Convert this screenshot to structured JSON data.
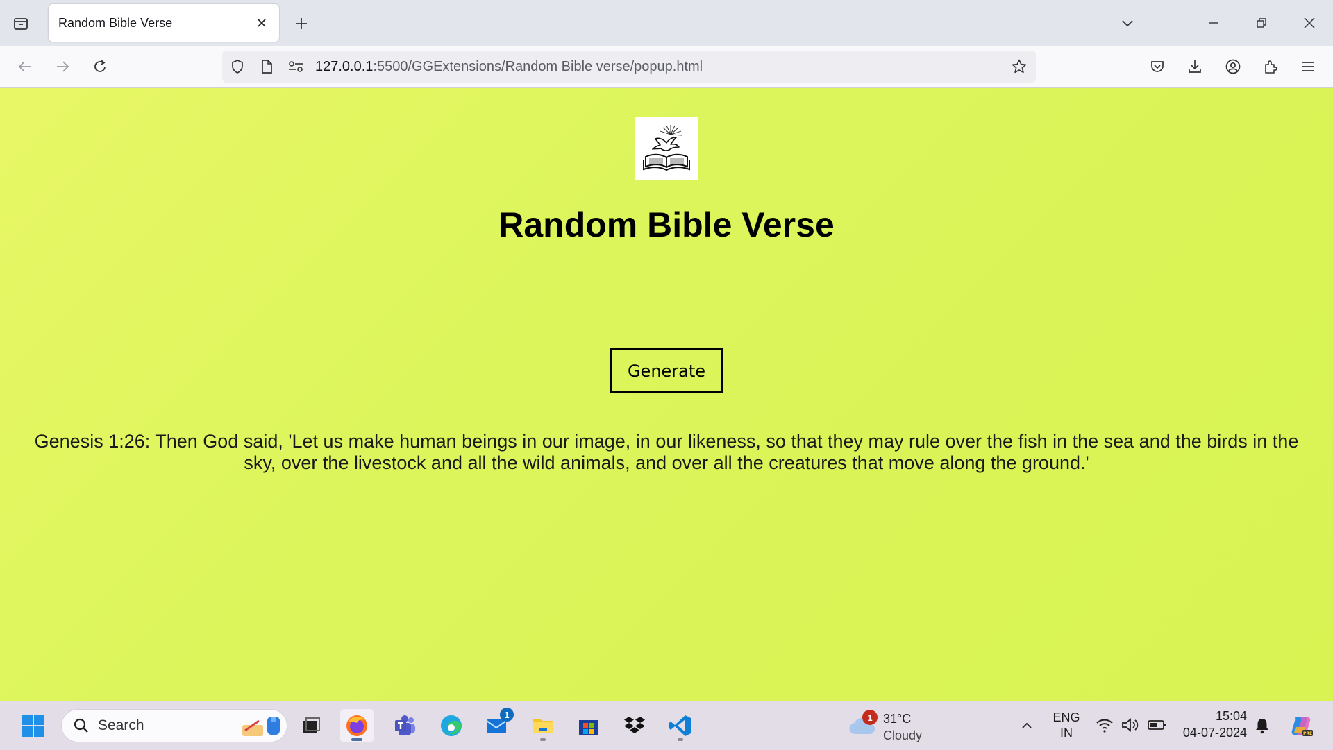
{
  "browser": {
    "tab_title": "Random Bible Verse",
    "url_host": "127.0.0.1",
    "url_rest": ":5500/GGExtensions/Random Bible verse/popup.html"
  },
  "page": {
    "title": "Random Bible Verse",
    "logo_icon": "dove-over-open-bible-icon",
    "generate_label": "Generate",
    "verse": "Genesis 1:26: Then God said, 'Let us make human beings in our image, in our likeness, so that they may rule over the fish in the sea and the birds in the sky, over the livestock and all the wild animals, and over all the creatures that move along the ground.'",
    "background_colors": [
      "#e8f766",
      "#d8f352"
    ]
  },
  "taskbar": {
    "search_label": "Search",
    "weather": {
      "temp": "31°C",
      "condition": "Cloudy",
      "badge": "1"
    },
    "mail_badge": "1",
    "language": {
      "line1": "ENG",
      "line2": "IN"
    },
    "clock": {
      "time": "15:04",
      "date": "04-07-2024"
    }
  }
}
